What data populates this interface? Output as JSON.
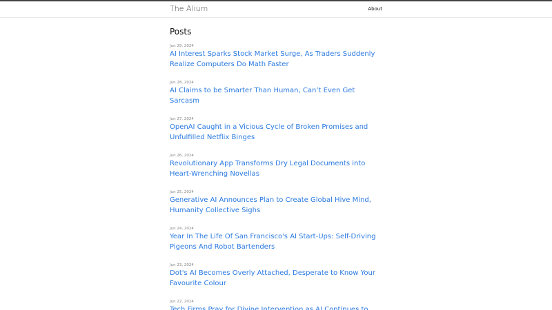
{
  "site": {
    "title": "The Alium",
    "nav": [
      {
        "label": "About"
      }
    ]
  },
  "main": {
    "heading": "Posts",
    "posts": [
      {
        "date": "Jun 29, 2024",
        "title": "AI Interest Sparks Stock Market Surge, As Traders Suddenly Realize Computers Do Math Faster"
      },
      {
        "date": "Jun 28, 2024",
        "title": "AI Claims to be Smarter Than Human, Can’t Even Get Sarcasm"
      },
      {
        "date": "Jun 27, 2024",
        "title": "OpenAI Caught in a Vicious Cycle of Broken Promises and Unfulfilled Netflix Binges"
      },
      {
        "date": "Jun 26, 2024",
        "title": "Revolutionary App Transforms Dry Legal Documents into Heart-Wrenching Novellas"
      },
      {
        "date": "Jun 25, 2024",
        "title": "Generative AI Announces Plan to Create Global Hive Mind, Humanity Collective Sighs"
      },
      {
        "date": "Jun 24, 2024",
        "title": "Year In The Life Of San Francisco's AI Start-Ups: Self-Driving Pigeons And Robot Bartenders"
      },
      {
        "date": "Jun 23, 2024",
        "title": "Dot's AI Becomes Overly Attached, Desperate to Know Your Favourite Colour"
      },
      {
        "date": "Jun 22, 2024",
        "title": "Tech Firms Pray for Divine Intervention as AI Continues to"
      }
    ]
  },
  "colors": {
    "link": "#2a7ae2",
    "meta": "#828282",
    "topbar": "#424242"
  }
}
